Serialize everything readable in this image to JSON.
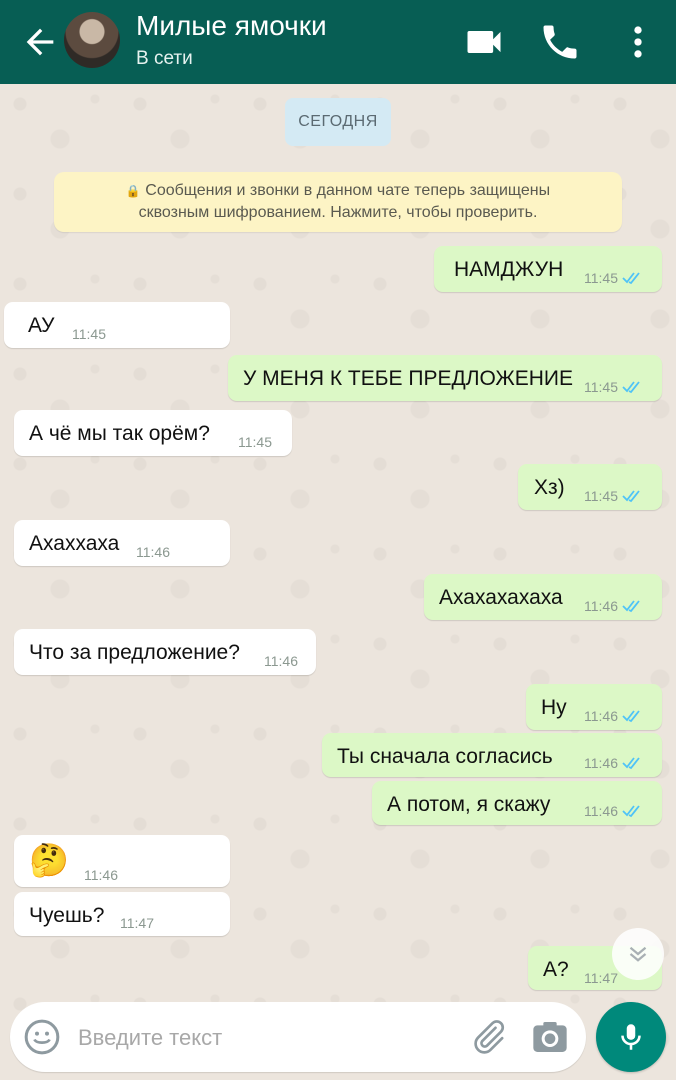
{
  "header": {
    "contact_name": "Милые ямочки",
    "status": "В сети"
  },
  "chat": {
    "date_label": "СЕГОДНЯ",
    "encryption_line1": "Сообщения и звонки в данном чате теперь защищены",
    "encryption_line2": "сквозным шифрованием. Нажмите, чтобы проверить.",
    "messages": [
      {
        "dir": "out",
        "text": "НАМДЖУН",
        "time": "11:45",
        "read": true
      },
      {
        "dir": "in",
        "text": "АУ",
        "time": "11:45"
      },
      {
        "dir": "out",
        "text": "У МЕНЯ К ТЕБЕ ПРЕДЛОЖЕНИЕ",
        "time": "11:45",
        "read": true
      },
      {
        "dir": "in",
        "text": "А чё мы так орём?",
        "time": "11:45"
      },
      {
        "dir": "out",
        "text": "Хз)",
        "time": "11:45",
        "read": true
      },
      {
        "dir": "in",
        "text": "Ахаххаха",
        "time": "11:46"
      },
      {
        "dir": "out",
        "text": "Ахахахахаха",
        "time": "11:46",
        "read": true
      },
      {
        "dir": "in",
        "text": "Что за предложение?",
        "time": "11:46"
      },
      {
        "dir": "out",
        "text": "Ну",
        "time": "11:46",
        "read": true
      },
      {
        "dir": "out",
        "text": "Ты сначала согласись",
        "time": "11:46",
        "read": true
      },
      {
        "dir": "out",
        "text": "А потом, я скажу",
        "time": "11:46",
        "read": true
      },
      {
        "dir": "in",
        "text": "🤔",
        "time": "11:46"
      },
      {
        "dir": "in",
        "text": "Чуешь?",
        "time": "11:47"
      },
      {
        "dir": "out",
        "text": "А?",
        "time": "11:47",
        "read": true
      }
    ]
  },
  "composer": {
    "placeholder": "Введите текст"
  },
  "colors": {
    "header": "#075e54",
    "outgoing_bubble": "#dcf8c6",
    "incoming_bubble": "#ffffff",
    "read_ticks": "#4fc3f7",
    "mic_button": "#00897b"
  },
  "icons": [
    "back-arrow-icon",
    "video-call-icon",
    "phone-icon",
    "more-vert-icon",
    "lock-icon",
    "double-check-icon",
    "chevron-down-icon",
    "emoji-icon",
    "paperclip-icon",
    "camera-icon",
    "mic-icon"
  ]
}
